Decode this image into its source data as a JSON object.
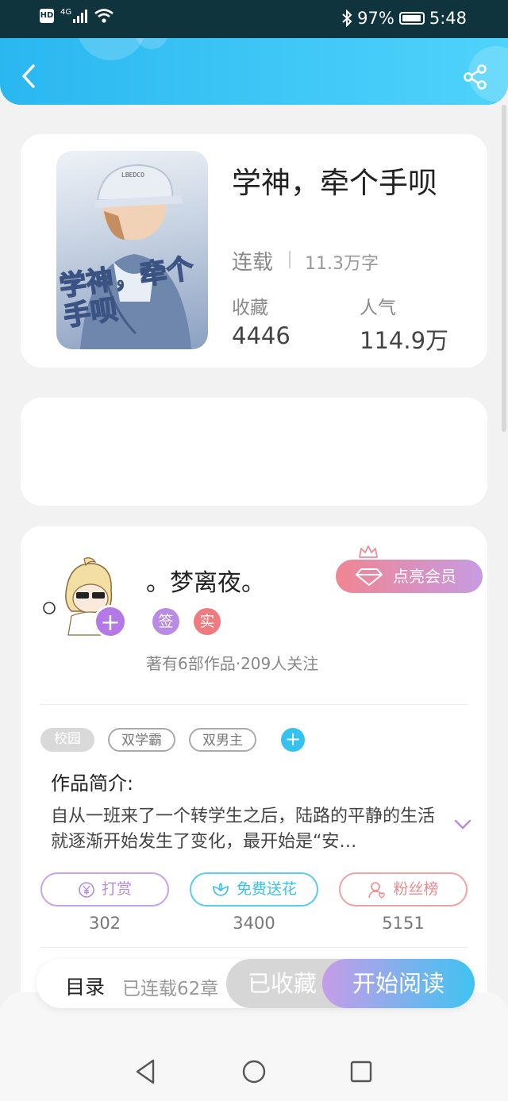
{
  "status_bar": {
    "hd": "HD",
    "network": "4G",
    "battery": "97%",
    "time": "5:48"
  },
  "book": {
    "title": "学神，牵个手呗",
    "status": "连载",
    "word_count": "11.3万字",
    "collect_label": "收藏",
    "collect_count": "4446",
    "popularity_label": "人气",
    "popularity_count": "114.9万",
    "cover_text": "学神，牵个手呗",
    "cover_cap_text": "LBEDCO"
  },
  "author": {
    "name": "。梦离夜。",
    "vip_label": "点亮会员",
    "badge_sign": "签",
    "badge_real": "实",
    "works_info": "著有6部作品·209人关注",
    "follow_symbol": "+"
  },
  "tags": [
    "校园",
    "双学霸",
    "双男主"
  ],
  "tag_add": "+",
  "intro": {
    "heading": "作品简介:",
    "text": "自从一班来了一个转学生之后，陆路的平静的生活就逐渐开始发生了变化，最开始是“安…"
  },
  "actions": [
    {
      "label": "打赏",
      "count": "302",
      "icon": "yen-coin-icon",
      "color": "#b58be0"
    },
    {
      "label": "免费送花",
      "count": "3400",
      "icon": "flower-icon",
      "color": "#38c2ec"
    },
    {
      "label": "粉丝榜",
      "count": "5151",
      "icon": "fan-person-icon",
      "color": "#ec8a8f"
    }
  ],
  "bottom_bar": {
    "toc": "目录",
    "chapters": "已连载62章",
    "collected": "已收藏",
    "read": "开始阅读"
  },
  "colors": {
    "header": "#2ab7f0",
    "accent_purple": "#b479e6",
    "sign_badge": "#b98be3",
    "real_badge": "#ee7b7f"
  }
}
